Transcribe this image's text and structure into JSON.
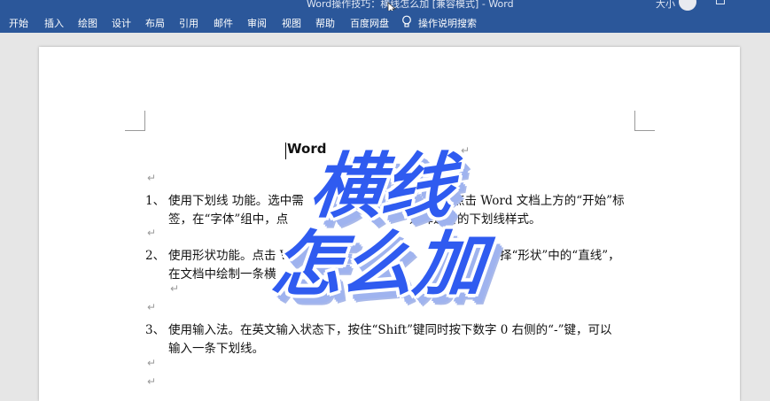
{
  "window": {
    "title": "Word操作技巧：横线怎么加 [兼容模式] - Word",
    "user": "大小"
  },
  "ribbon": {
    "tabs": [
      "开始",
      "插入",
      "绘图",
      "设计",
      "布局",
      "引用",
      "邮件",
      "审阅",
      "视图",
      "帮助",
      "百度网盘"
    ],
    "tell_me": "操作说明搜索"
  },
  "document": {
    "heading": "Word",
    "para_mark": "↵",
    "items": [
      {
        "num": "1、",
        "line1": "使用下划线   功能。选中需",
        "line1b": "点击 Word 文档上方的“开始”标",
        "line2": "签，在“字体”组中，点",
        "line2b": "选择适合的下划线样式。"
      },
      {
        "num": "2、",
        "line1": "使用形状功能。点击 Wo",
        "line1b": "择“形状”中的“直线”，",
        "line2": "在文档中绘制一条横"
      },
      {
        "num": "3、",
        "line1": "使用输入法。在英文输入状态下，按住“Shift”键同时按下数字 0 右侧的“-”键，可以",
        "line2": "输入一条下划线。"
      }
    ]
  },
  "overlay": {
    "line1": "横线",
    "line2": "怎么加"
  }
}
